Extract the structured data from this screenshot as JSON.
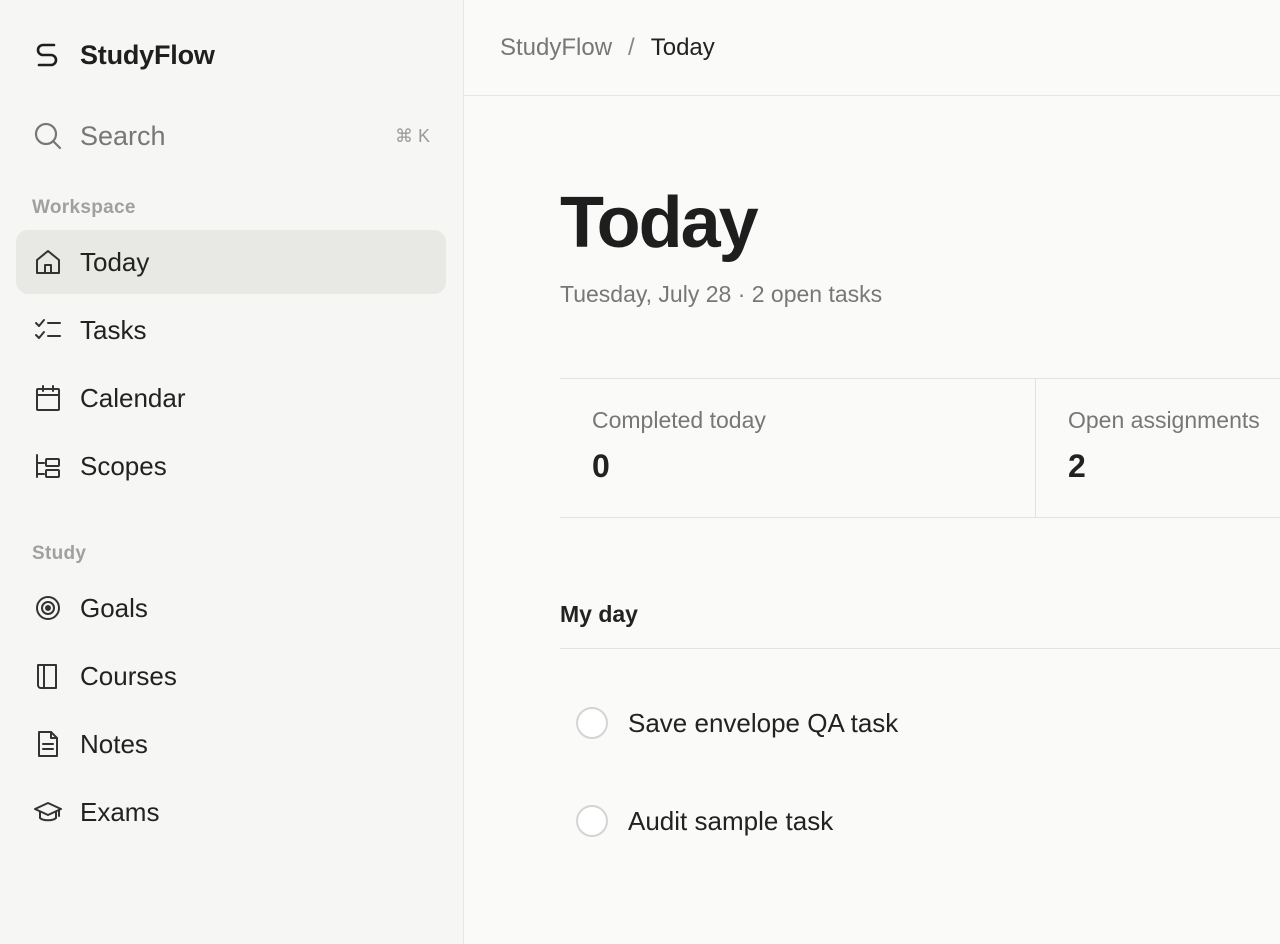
{
  "app": {
    "name": "StudyFlow"
  },
  "search": {
    "label": "Search",
    "shortcut": "⌘ K"
  },
  "sidebar": {
    "workspace_label": "Workspace",
    "workspace_items": [
      {
        "label": "Today",
        "icon": "home-icon",
        "active": true
      },
      {
        "label": "Tasks",
        "icon": "checklist-icon"
      },
      {
        "label": "Calendar",
        "icon": "calendar-icon"
      },
      {
        "label": "Scopes",
        "icon": "hierarchy-icon"
      }
    ],
    "study_label": "Study",
    "study_items": [
      {
        "label": "Goals",
        "icon": "target-icon"
      },
      {
        "label": "Courses",
        "icon": "book-icon"
      },
      {
        "label": "Notes",
        "icon": "document-icon"
      },
      {
        "label": "Exams",
        "icon": "graduation-cap-icon"
      }
    ]
  },
  "breadcrumb": {
    "root": "StudyFlow",
    "separator": "/",
    "current": "Today"
  },
  "page": {
    "title": "Today",
    "subtitle": "Tuesday, July 28 · 2 open tasks"
  },
  "stats": [
    {
      "label": "Completed today",
      "value": "0"
    },
    {
      "label": "Open assignments",
      "value": "2"
    }
  ],
  "my_day": {
    "heading": "My day",
    "tasks": [
      {
        "title": "Save envelope QA task",
        "done": false
      },
      {
        "title": "Audit sample task",
        "done": false
      }
    ]
  },
  "colors": {
    "sidebar_bg": "#f6f6f4",
    "active_bg": "#e8e8e4",
    "main_bg": "#fafaf9",
    "muted_text": "#777777"
  }
}
